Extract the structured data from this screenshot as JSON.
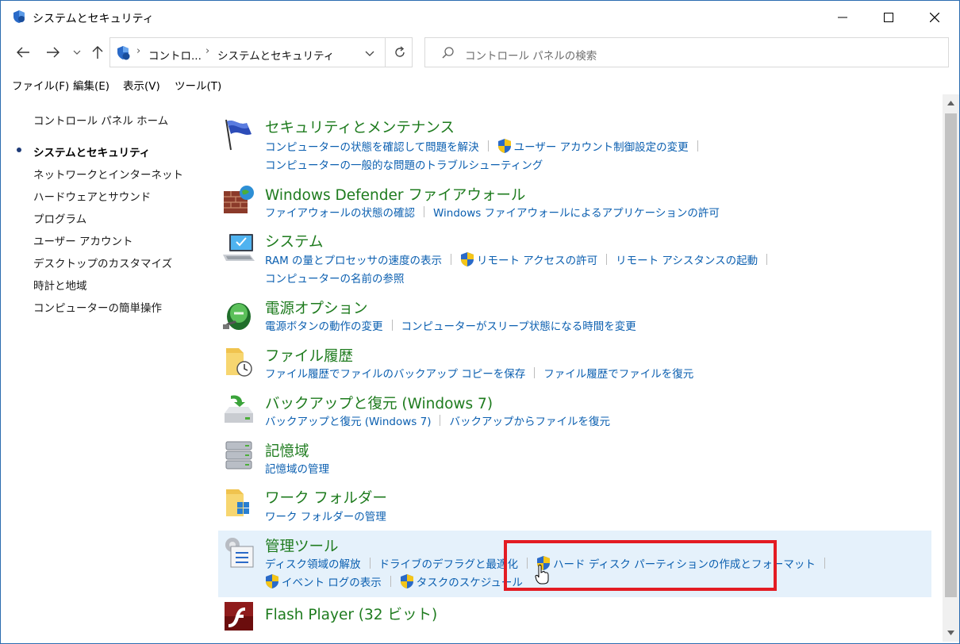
{
  "window": {
    "title": "システムとセキュリティ"
  },
  "address": {
    "crumbs": [
      "コントロ...",
      "システムとセキュリティ"
    ],
    "search_placeholder": "コントロール パネルの検索"
  },
  "menu": [
    "ファイル(F)",
    "編集(E)",
    "表示(V)",
    "ツール(T)"
  ],
  "sidebar": {
    "home": "コントロール パネル ホーム",
    "items": [
      {
        "label": "システムとセキュリティ",
        "current": true
      },
      {
        "label": "ネットワークとインターネット"
      },
      {
        "label": "ハードウェアとサウンド"
      },
      {
        "label": "プログラム"
      },
      {
        "label": "ユーザー アカウント"
      },
      {
        "label": "デスクトップのカスタマイズ"
      },
      {
        "label": "時計と地域"
      },
      {
        "label": "コンピューターの簡単操作"
      }
    ]
  },
  "categories": [
    {
      "title": "セキュリティとメンテナンス",
      "icon": "flag-icon",
      "rows": [
        [
          {
            "label": "コンピューターの状態を確認して問題を解決"
          },
          {
            "label": "ユーザー アカウント制御設定の変更",
            "shield": true
          }
        ],
        [
          {
            "label": "コンピューターの一般的な問題のトラブルシューティング"
          }
        ]
      ]
    },
    {
      "title": "Windows Defender ファイアウォール",
      "icon": "firewall-icon",
      "rows": [
        [
          {
            "label": "ファイアウォールの状態の確認"
          },
          {
            "label": "Windows ファイアウォールによるアプリケーションの許可"
          }
        ]
      ]
    },
    {
      "title": "システム",
      "icon": "computer-icon",
      "rows": [
        [
          {
            "label": "RAM の量とプロセッサの速度の表示"
          },
          {
            "label": "リモート アクセスの許可",
            "shield": true
          },
          {
            "label": "リモート アシスタンスの起動"
          }
        ],
        [
          {
            "label": "コンピューターの名前の参照"
          }
        ]
      ]
    },
    {
      "title": "電源オプション",
      "icon": "battery-icon",
      "rows": [
        [
          {
            "label": "電源ボタンの動作の変更"
          },
          {
            "label": "コンピューターがスリープ状態になる時間を変更"
          }
        ]
      ]
    },
    {
      "title": "ファイル履歴",
      "icon": "file-history-icon",
      "rows": [
        [
          {
            "label": "ファイル履歴でファイルのバックアップ コピーを保存"
          },
          {
            "label": "ファイル履歴でファイルを復元"
          }
        ]
      ]
    },
    {
      "title": "バックアップと復元 (Windows 7)",
      "icon": "backup-icon",
      "rows": [
        [
          {
            "label": "バックアップと復元 (Windows 7)"
          },
          {
            "label": "バックアップからファイルを復元"
          }
        ]
      ]
    },
    {
      "title": "記憶域",
      "icon": "storage-icon",
      "rows": [
        [
          {
            "label": "記憶域の管理"
          }
        ]
      ]
    },
    {
      "title": "ワーク フォルダー",
      "icon": "work-folders-icon",
      "rows": [
        [
          {
            "label": "ワーク フォルダーの管理"
          }
        ]
      ]
    },
    {
      "title": "管理ツール",
      "icon": "admin-tools-icon",
      "rows": [
        [
          {
            "label": "ディスク領域の解放"
          },
          {
            "label": "ドライブのデフラグと最適化"
          },
          {
            "label": "ハード ディスク パーティションの作成とフォーマット",
            "shield": true
          }
        ],
        [
          {
            "label": "イベント ログの表示",
            "shield": true
          },
          {
            "label": "タスクのスケジュール",
            "shield": true
          }
        ]
      ]
    },
    {
      "title": "Flash Player (32 ビット)",
      "icon": "flash-icon",
      "rows": []
    }
  ],
  "colors": {
    "title_green": "#1e7b1e",
    "link_blue": "#0b5fb0",
    "highlight": "#e5f1fb",
    "annotation_red": "#e31c23"
  }
}
